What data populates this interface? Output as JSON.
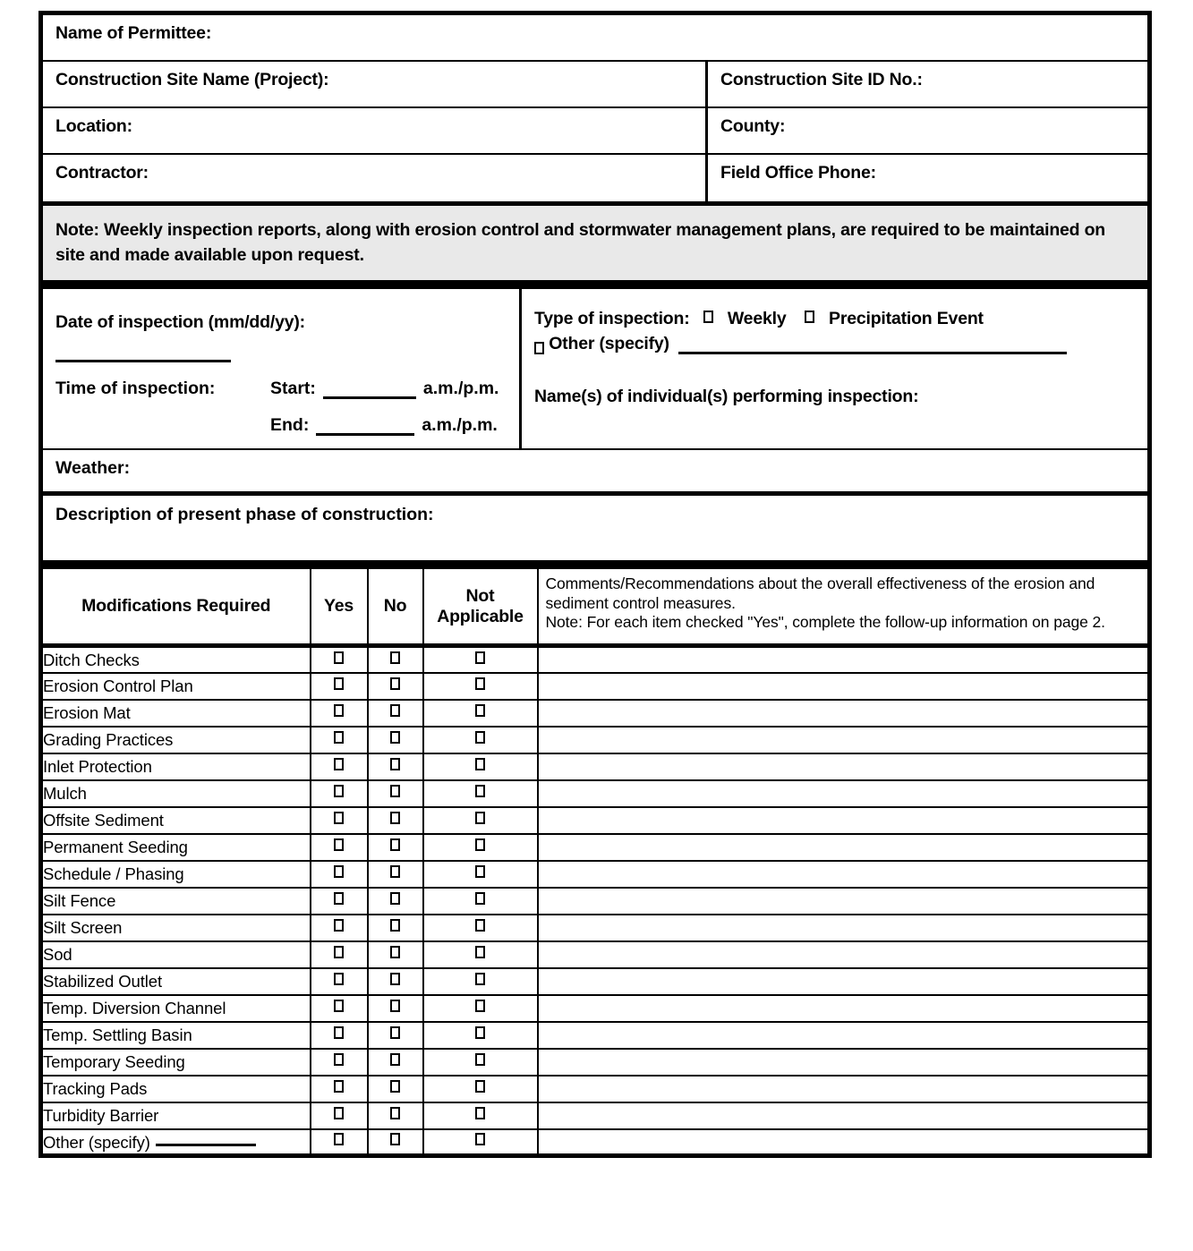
{
  "identity": {
    "permittee_label": "Name of Permittee:",
    "site_name_label": "Construction Site Name (Project):",
    "site_id_label": "Construction Site ID No.:",
    "location_label": "Location:",
    "county_label": "County:",
    "contractor_label": "Contractor:",
    "field_office_phone_label": "Field Office Phone:"
  },
  "note": {
    "text": "Note:  Weekly inspection reports, along with erosion control and stormwater management plans, are required to be maintained on site and made available upon request.",
    "background_color": "#e9e9e9"
  },
  "inspection": {
    "date_label": "Date of inspection (mm/dd/yy):",
    "time_label": "Time of inspection:",
    "start_label": "Start:",
    "end_label": "End:",
    "ampm": "a.m./p.m.",
    "type_label": "Type of inspection:",
    "type_options": [
      "Weekly",
      "Precipitation Event"
    ],
    "other_label": "Other  (specify)",
    "names_label": "Name(s) of individual(s) performing inspection:"
  },
  "weather": {
    "label": "Weather:"
  },
  "description": {
    "label": "Description of present phase of construction:"
  },
  "checklist": {
    "headers": {
      "item": "Modifications Required",
      "yes": "Yes",
      "no": "No",
      "not_applicable_line1": "Not",
      "not_applicable_line2": "Applicable",
      "comments": "Comments/Recommendations about the overall effectiveness of the erosion and sediment control measures.\nNote: For each item checked \"Yes\", complete the follow-up information on page 2."
    },
    "rows": [
      {
        "label": "Ditch Checks"
      },
      {
        "label": "Erosion Control Plan"
      },
      {
        "label": "Erosion Mat"
      },
      {
        "label": "Grading Practices"
      },
      {
        "label": "Inlet Protection"
      },
      {
        "label": "Mulch"
      },
      {
        "label": "Offsite Sediment"
      },
      {
        "label": "Permanent Seeding"
      },
      {
        "label": "Schedule / Phasing"
      },
      {
        "label": "Silt Fence"
      },
      {
        "label": "Silt Screen"
      },
      {
        "label": "Sod"
      },
      {
        "label": "Stabilized Outlet"
      },
      {
        "label": "Temp. Diversion Channel"
      },
      {
        "label": "Temp. Settling Basin"
      },
      {
        "label": "Temporary Seeding"
      },
      {
        "label": "Tracking Pads"
      },
      {
        "label": "Turbidity Barrier"
      },
      {
        "label": "Other (specify)",
        "has_blank_line": true
      }
    ]
  }
}
